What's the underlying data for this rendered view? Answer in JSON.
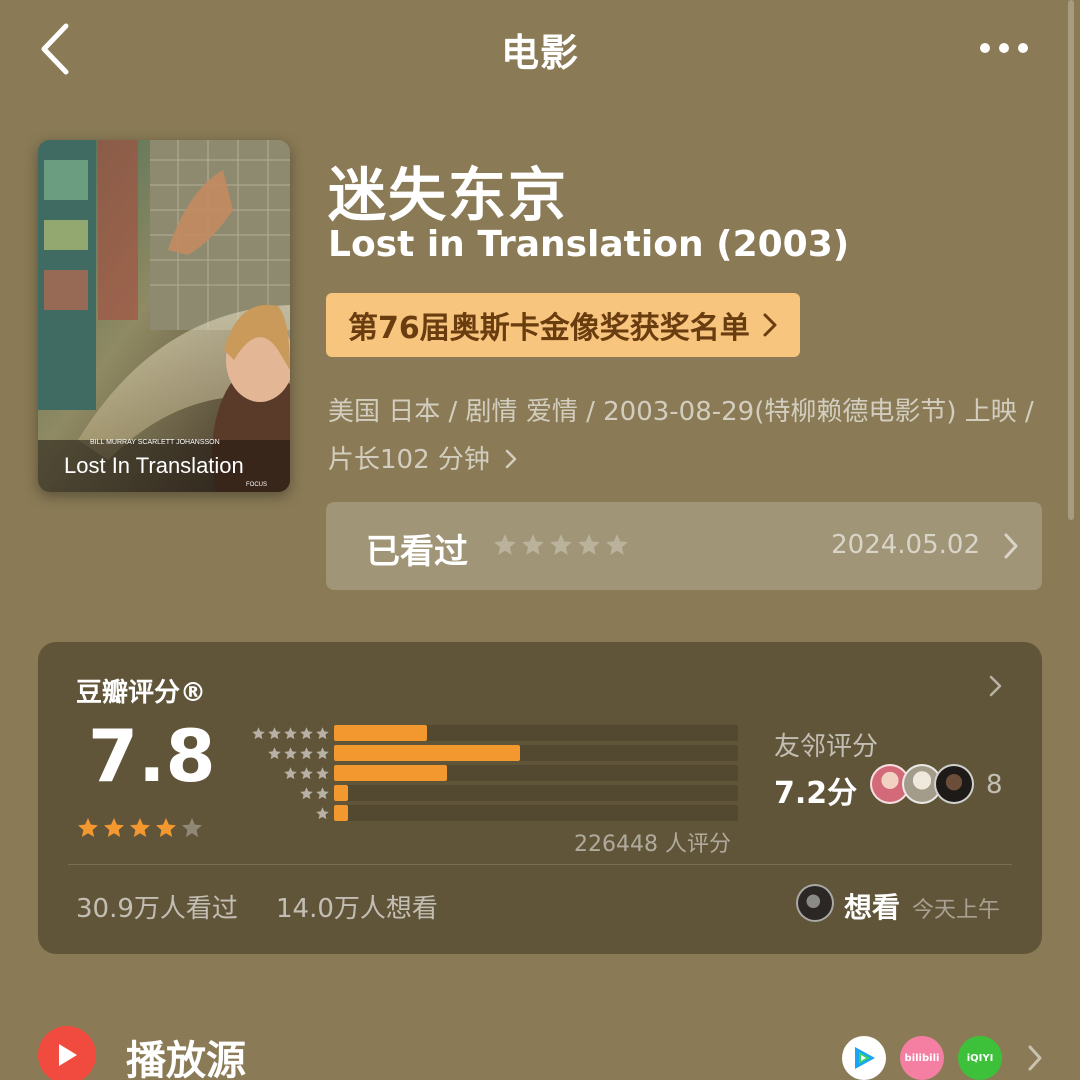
{
  "header": {
    "title": "电影",
    "back_icon": "chevron-left-icon",
    "more_icon": "more-horizontal-icon"
  },
  "movie": {
    "poster": {
      "credits": "BILL MURRAY    SCARLETT JOHANSSON",
      "title": "Lost In Translation",
      "studio": "FOCUS"
    },
    "title_cn": "迷失东京",
    "title_en": "Lost in Translation (2003)",
    "award": "第76届奥斯卡金像奖获奖名单",
    "meta": "美国 日本 / 剧情 爱情 / 2003-08-29(特柳赖德电影节) 上映 / 片长102 分钟"
  },
  "watched": {
    "label": "已看过",
    "stars_filled": 0,
    "date": "2024.05.02"
  },
  "rating": {
    "header": "豆瓣评分®",
    "score": "7.8",
    "stars_value": 4,
    "distribution": [
      {
        "stars": 5,
        "fraction": 0.23
      },
      {
        "stars": 4,
        "fraction": 0.46
      },
      {
        "stars": 3,
        "fraction": 0.28
      },
      {
        "stars": 2,
        "fraction": 0.035
      },
      {
        "stars": 1,
        "fraction": 0.035
      }
    ],
    "count": "226448 人评分",
    "friends_label": "友邻评分",
    "friends_score": "7.2分",
    "friends_count": "8",
    "watched_count": "30.9万人看过",
    "want_count": "14.0万人想看",
    "activity_action": "想看",
    "activity_time": "今天上午"
  },
  "sources": {
    "label": "播放源",
    "items": [
      {
        "name": "tencent-video-icon",
        "text": ""
      },
      {
        "name": "bilibili-icon",
        "text": "bilibili"
      },
      {
        "name": "iqiyi-icon",
        "text": "iQIYI"
      }
    ]
  },
  "colors": {
    "background": "#8a7b56",
    "accent_orange": "#f3972f",
    "award_bg": "#f7c57d",
    "award_text": "#6a3d10",
    "play_red": "#f04b3e"
  }
}
